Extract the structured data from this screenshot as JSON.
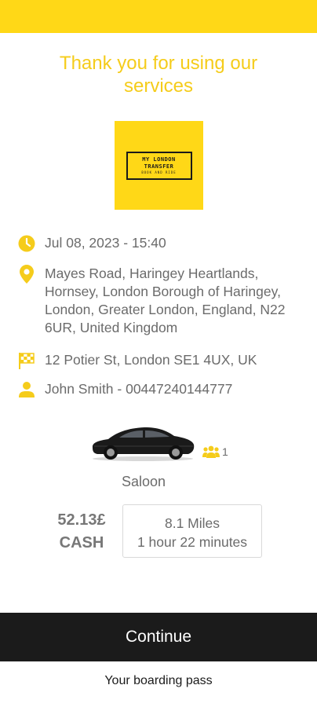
{
  "header": {
    "title": "Thank you for using our services"
  },
  "logo": {
    "line1": "MY LONDON",
    "line2": "TRANSFER",
    "line3": "BOOK AND RIDE"
  },
  "booking": {
    "datetime": "Jul 08, 2023 - 15:40",
    "pickup": "Mayes Road, Haringey Heartlands, Hornsey, London Borough of Haringey, London, Greater London, England, N22 6UR, United Kingdom",
    "dropoff": "12 Potier St, London SE1 4UX, UK",
    "passenger": "John Smith - 00447240144777"
  },
  "vehicle": {
    "type": "Saloon",
    "passengers": "1"
  },
  "fare": {
    "amount": "52.13£",
    "method": "CASH"
  },
  "trip": {
    "distance": "8.1 Miles",
    "duration": "1 hour 22 minutes"
  },
  "actions": {
    "continue_label": "Continue",
    "boarding_pass_label": "Your boarding pass"
  },
  "colors": {
    "accent": "#ffd817",
    "title": "#f5cc1b",
    "button": "#1b1b1b"
  },
  "icons": [
    "clock-icon",
    "location-pin-icon",
    "checkered-flag-icon",
    "person-icon",
    "group-icon"
  ]
}
